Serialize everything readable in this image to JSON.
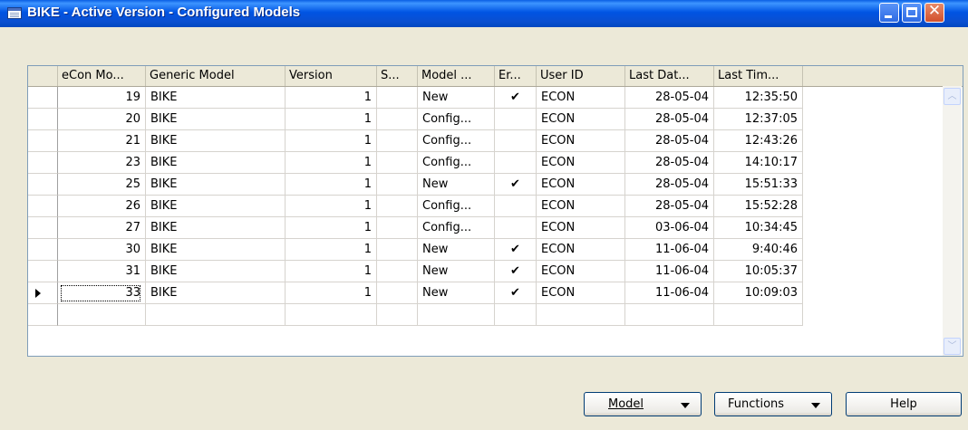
{
  "window": {
    "title": "BIKE - Active Version - Configured Models",
    "minimize_icon": "minimize-icon",
    "maximize_icon": "maximize-icon",
    "close_icon": "close-icon",
    "close_glyph": "✕"
  },
  "table": {
    "columns": [
      "eCon Mo...",
      "Generic Model",
      "Version",
      "S...",
      "Model ...",
      "Er...",
      "User ID",
      "Last Dat...",
      "Last Tim..."
    ],
    "rows": [
      {
        "econ_model": "19",
        "generic_model": "BIKE",
        "version": "1",
        "s": "",
        "model_status": "New",
        "error": "✔",
        "user_id": "ECON",
        "last_date": "28-05-04",
        "last_time": "12:35:50"
      },
      {
        "econ_model": "20",
        "generic_model": "BIKE",
        "version": "1",
        "s": "",
        "model_status": "Config...",
        "error": "",
        "user_id": "ECON",
        "last_date": "28-05-04",
        "last_time": "12:37:05"
      },
      {
        "econ_model": "21",
        "generic_model": "BIKE",
        "version": "1",
        "s": "",
        "model_status": "Config...",
        "error": "",
        "user_id": "ECON",
        "last_date": "28-05-04",
        "last_time": "12:43:26"
      },
      {
        "econ_model": "23",
        "generic_model": "BIKE",
        "version": "1",
        "s": "",
        "model_status": "Config...",
        "error": "",
        "user_id": "ECON",
        "last_date": "28-05-04",
        "last_time": "14:10:17"
      },
      {
        "econ_model": "25",
        "generic_model": "BIKE",
        "version": "1",
        "s": "",
        "model_status": "New",
        "error": "✔",
        "user_id": "ECON",
        "last_date": "28-05-04",
        "last_time": "15:51:33"
      },
      {
        "econ_model": "26",
        "generic_model": "BIKE",
        "version": "1",
        "s": "",
        "model_status": "Config...",
        "error": "",
        "user_id": "ECON",
        "last_date": "28-05-04",
        "last_time": "15:52:28"
      },
      {
        "econ_model": "27",
        "generic_model": "BIKE",
        "version": "1",
        "s": "",
        "model_status": "Config...",
        "error": "",
        "user_id": "ECON",
        "last_date": "03-06-04",
        "last_time": "10:34:45"
      },
      {
        "econ_model": "30",
        "generic_model": "BIKE",
        "version": "1",
        "s": "",
        "model_status": "New",
        "error": "✔",
        "user_id": "ECON",
        "last_date": "11-06-04",
        "last_time": "9:40:46"
      },
      {
        "econ_model": "31",
        "generic_model": "BIKE",
        "version": "1",
        "s": "",
        "model_status": "New",
        "error": "✔",
        "user_id": "ECON",
        "last_date": "11-06-04",
        "last_time": "10:05:37"
      },
      {
        "econ_model": "33",
        "generic_model": "BIKE",
        "version": "1",
        "s": "",
        "model_status": "New",
        "error": "✔",
        "user_id": "ECON",
        "last_date": "11-06-04",
        "last_time": "10:09:03"
      }
    ],
    "selected_row_index": 9,
    "selected_row_icon": "row-pointer-icon"
  },
  "scrollbar": {
    "up_icon": "chevron-up-icon",
    "down_icon": "chevron-down-icon",
    "up_glyph": "︿",
    "down_glyph": "﹀"
  },
  "buttons": {
    "model_label": "Model",
    "functions_label": "Functions",
    "help_label": "Help",
    "dropdown_icon": "triangle-down-icon"
  }
}
